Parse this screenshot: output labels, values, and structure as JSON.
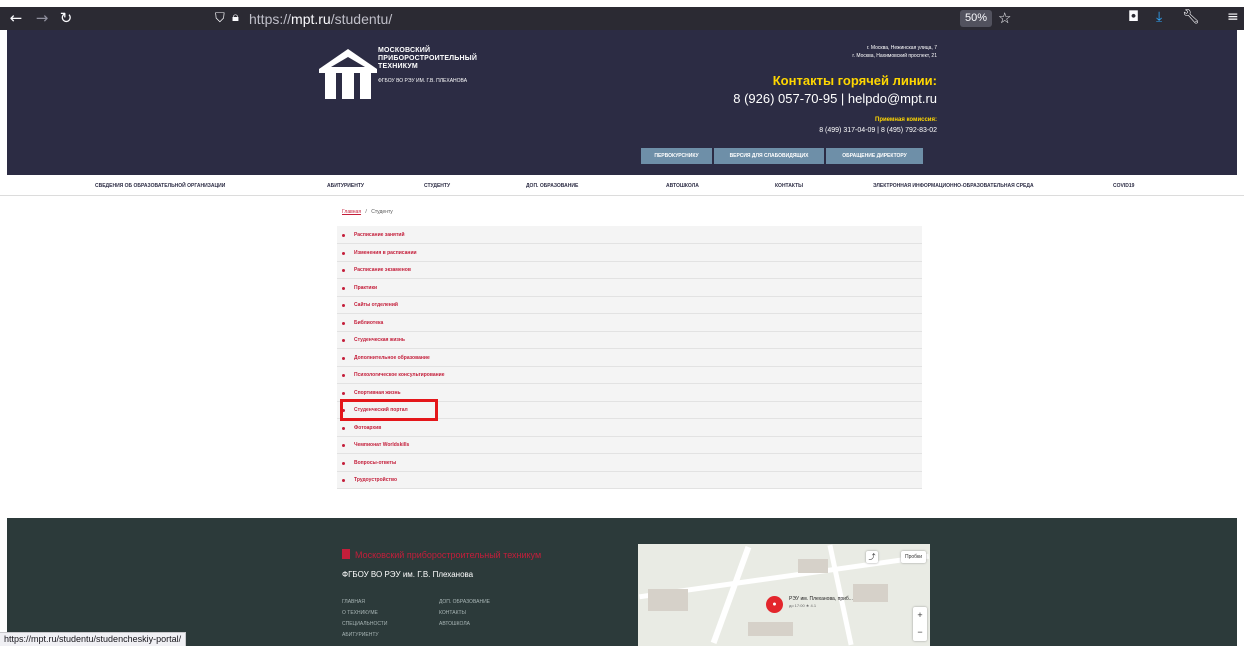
{
  "browser": {
    "url_prefix": "https://",
    "url_host": "mpt.ru",
    "url_path": "/studentu/",
    "zoom": "50%",
    "icons": {
      "back": "arrow-left-icon",
      "forward": "arrow-right-icon",
      "reload": "reload-icon",
      "shield": "shield-icon",
      "lock": "lock-icon",
      "bookmark": "star-icon",
      "pocket": "pocket-icon",
      "downloads": "download-icon",
      "tools": "wrench-icon",
      "menu": "hamburger-icon"
    },
    "status_url": "https://mpt.ru/studentu/studencheskiy-portal/"
  },
  "header": {
    "logo_line1": "МОСКОВСКИЙ",
    "logo_line2": "ПРИБОРОСТРОИТЕЛЬНЫЙ",
    "logo_line3": "ТЕХНИКУМ",
    "logo_sub": "ФГБОУ ВО РЭУ ИМ. Г.В. ПЛЕХАНОВА",
    "address1": "г. Москва, Нежинская улица, 7",
    "address2": "г. Москва, Нахимовский проспект, 21",
    "hotline_title": "Контакты горячей линии:",
    "hotline_phone": "8 (926) 057-70-95 | helpdo@mpt.ru",
    "admission_title": "Приемная комиссия:",
    "admission_phones": "8 (499) 317-04-09 | 8 (495) 792-83-02",
    "buttons": [
      "ПЕРВОКУРСНИКУ",
      "ВЕРСИЯ ДЛЯ СЛАБОВИДЯЩИХ",
      "ОБРАЩЕНИЕ ДИРЕКТОРУ"
    ]
  },
  "nav": [
    "СВЕДЕНИЯ ОБ ОБРАЗОВАТЕЛЬНОЙ ОРГАНИЗАЦИИ",
    "АБИТУРИЕНТУ",
    "СТУДЕНТУ",
    "ДОП. ОБРАЗОВАНИЕ",
    "АВТОШКОЛА",
    "КОНТАКТЫ",
    "ЭЛЕКТРОННАЯ ИНФОРМАЦИОННО-ОБРАЗОВАТЕЛЬНАЯ СРЕДА",
    "COVID19"
  ],
  "breadcrumb": {
    "home": "Главная",
    "separator": "/",
    "current": "Студенту"
  },
  "student_links": [
    "Расписание занятий",
    "Изменения в расписании",
    "Расписание экзаменов",
    "Практики",
    "Сайты отделений",
    "Библиотека",
    "Студенческая жизнь",
    "Дополнительное образование",
    "Психологическое консультирование",
    "Спортивная жизнь",
    "Студенческий портал",
    "Фотоархив",
    "Чемпионат Worldskills",
    "Вопросы-ответы",
    "Трудоустройство"
  ],
  "footer": {
    "brand": "Московский приборостроительный техникум",
    "sub": "ФГБОУ ВО РЭУ им. Г.В. Плеханова",
    "links_col1": [
      "ГЛАВНАЯ",
      "О ТЕХНИКУМЕ",
      "СПЕЦИАЛЬНОСТИ",
      "АБИТУРИЕНТУ"
    ],
    "links_col2": [
      "ДОП. ОБРАЗОВАНИЕ",
      "КОНТАКТЫ",
      "АВТОШКОЛА"
    ]
  },
  "map": {
    "traffic_label": "Пробки",
    "place_name": "РЭУ им. Плеханова, приб...",
    "place_hours": "до 17:00 ★ 4.1",
    "zoom_in": "+",
    "zoom_out": "−"
  },
  "colors": {
    "header_bg": "#2c2c44",
    "accent_red": "#c41e3a",
    "hotline_yellow": "#ffd700",
    "header_button": "#6e8fa8",
    "footer_bg": "#2c3a3a",
    "highlight": "#e4161a"
  }
}
